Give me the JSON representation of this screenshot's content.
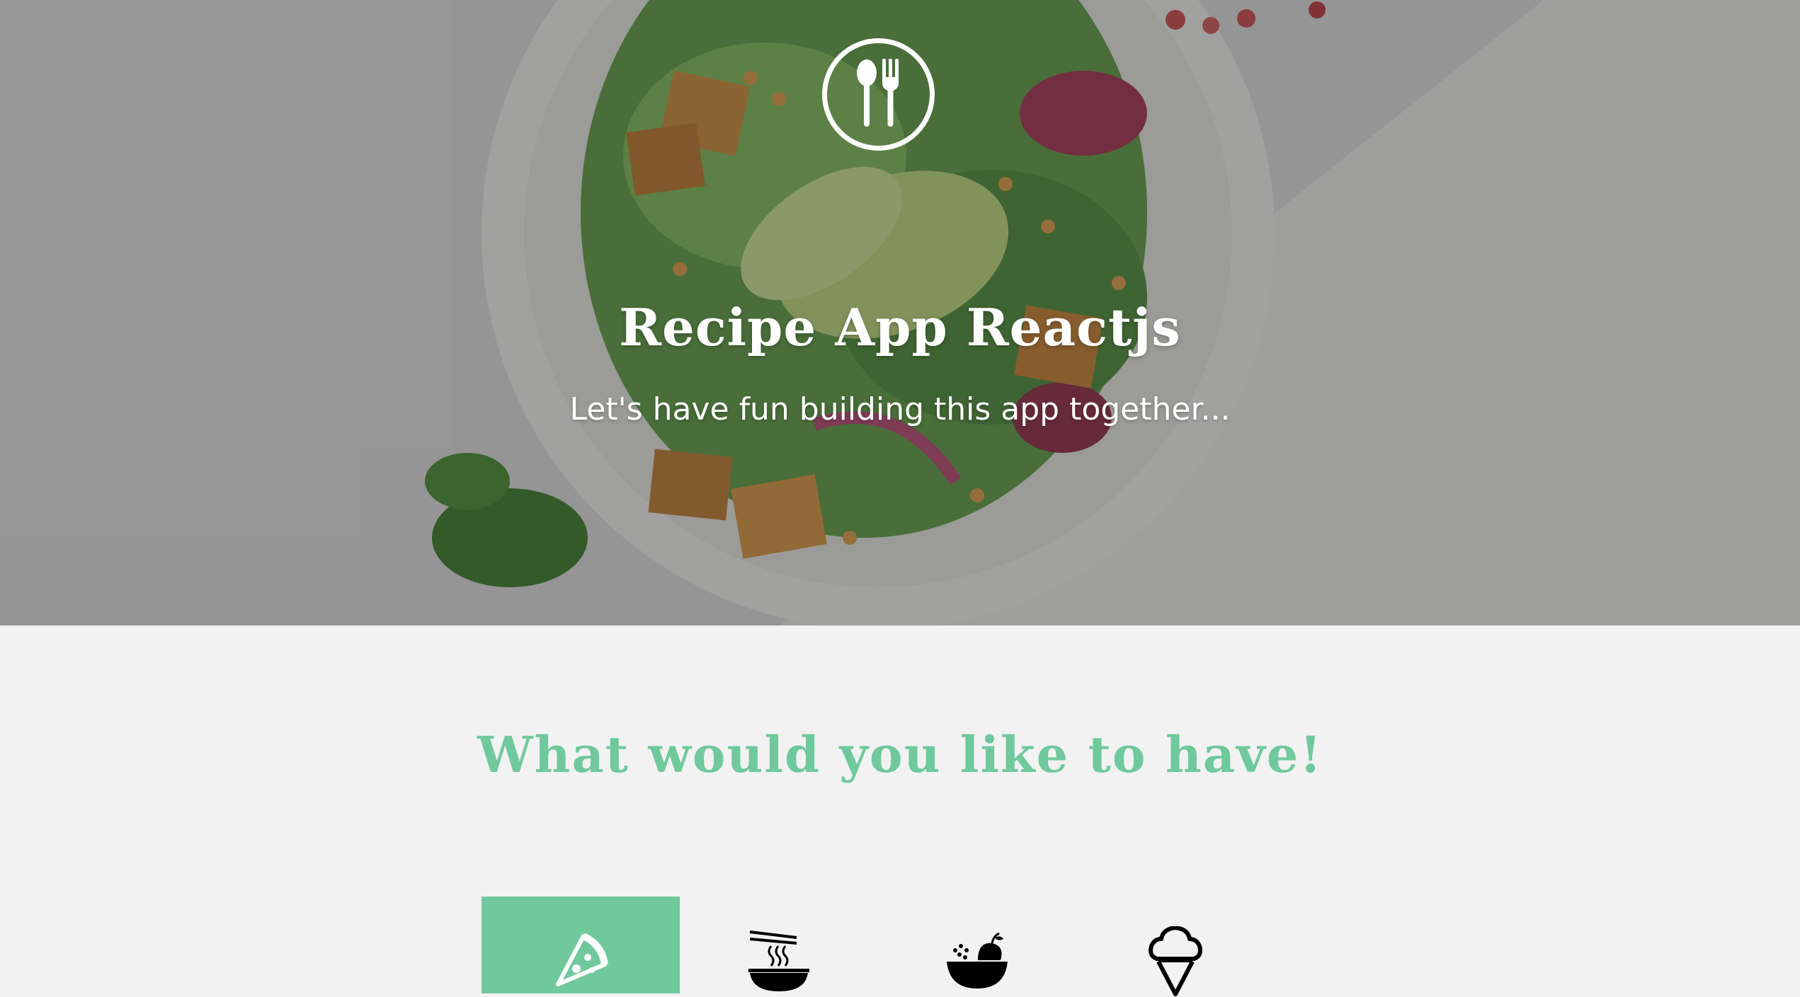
{
  "hero": {
    "title": "Recipe App Reactjs",
    "subtitle": "Let's have fun building this app together...",
    "logo_icon": "spoon-fork-icon"
  },
  "section": {
    "title": "What would you like to have!"
  },
  "categories": {
    "active_index": 0,
    "items": [
      {
        "icon": "pizza-icon"
      },
      {
        "icon": "noodles-bowl-icon"
      },
      {
        "icon": "salad-bowl-icon"
      },
      {
        "icon": "ice-cream-icon"
      }
    ]
  },
  "colors": {
    "accent": "#70c99d",
    "page_background": "#f2f2f2",
    "hero_text": "#ffffff"
  }
}
